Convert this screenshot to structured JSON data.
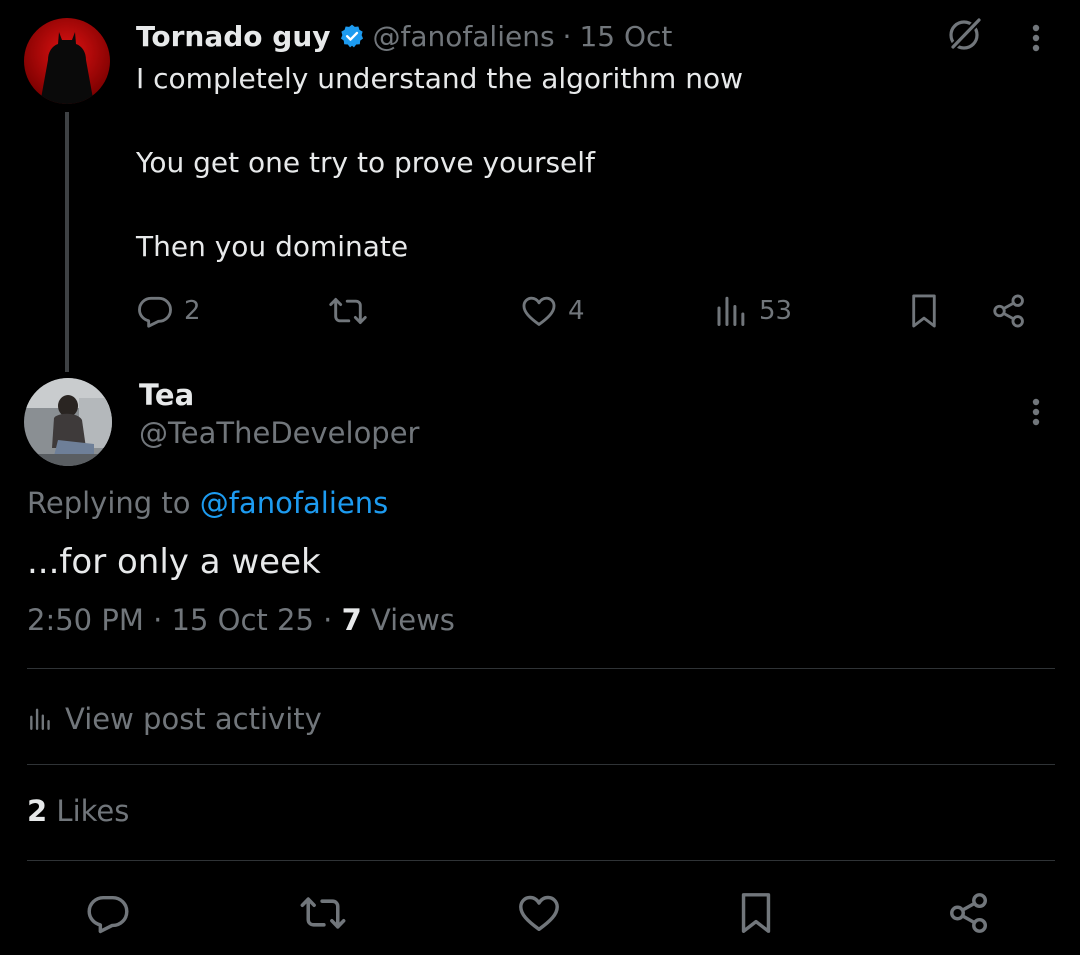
{
  "parent_tweet": {
    "name": "Tornado guy",
    "handle": "@fanofaliens",
    "separator": "·",
    "date": "15 Oct",
    "verified": true,
    "lines": [
      "I completely understand the algorithm now",
      "You get one try to prove yourself",
      "Then you dominate"
    ],
    "stats": {
      "replies": "2",
      "likes": "4",
      "views": "53"
    },
    "icons": [
      "reply-icon",
      "retweet-icon",
      "heart-icon",
      "views-icon",
      "bookmark-icon",
      "share-icon",
      "grok-icon",
      "more-icon"
    ]
  },
  "reply_tweet": {
    "name": "Tea",
    "handle": "@TeaTheDeveloper",
    "replying_prefix": "Replying to",
    "replying_mention": "@fanofaliens",
    "text": "...for only a week",
    "time": "2:50 PM",
    "separator": "·",
    "date": "15 Oct 25",
    "views_count": "7",
    "views_label": "Views"
  },
  "activity": {
    "label": "View post activity"
  },
  "likes_summary": {
    "count": "2",
    "label": "Likes"
  },
  "bottom_actions": [
    "reply-icon",
    "retweet-icon",
    "heart-icon",
    "bookmark-icon",
    "share-icon"
  ],
  "colors": {
    "background": "#000000",
    "primary_text": "#e7e9ea",
    "secondary_text": "#71767b",
    "accent": "#1d9bf0",
    "divider": "#2f3336"
  }
}
